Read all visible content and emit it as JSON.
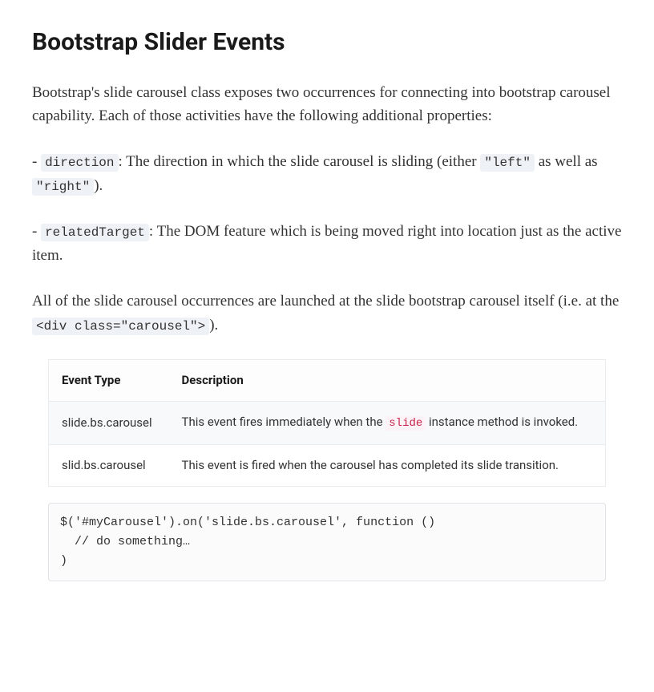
{
  "heading": "Bootstrap Slider Events",
  "intro": "Bootstrap's slide carousel class exposes two occurrences for connecting into bootstrap carousel capability. Each of those activities have the following additional properties:",
  "bullet1": {
    "prefix": "- ",
    "token": "direction",
    "mid1": ": The direction in which the slide carousel is sliding (either ",
    "code_left": "\"left\"",
    "mid2": " as well as ",
    "code_right": "\"right\"",
    "suffix": ")."
  },
  "bullet2": {
    "prefix": "- ",
    "token": "relatedTarget",
    "suffix": ": The DOM feature which is being moved right into location just as the active item."
  },
  "para3": {
    "text1": "All of the slide carousel occurrences are launched at the slide bootstrap carousel itself (i.e. at the ",
    "code": "<div class=\"carousel\">",
    "text2": ")."
  },
  "table": {
    "headers": [
      "Event Type",
      "Description"
    ],
    "rows": [
      {
        "event": "slide.bs.carousel",
        "desc_before": "This event fires immediately when the ",
        "desc_code": "slide",
        "desc_after": " instance method is invoked."
      },
      {
        "event": "slid.bs.carousel",
        "desc_plain": "This event is fired when the carousel has completed its slide transition."
      }
    ]
  },
  "codeblock": "$('#myCarousel').on('slide.bs.carousel', function ()\n  // do something…\n)"
}
